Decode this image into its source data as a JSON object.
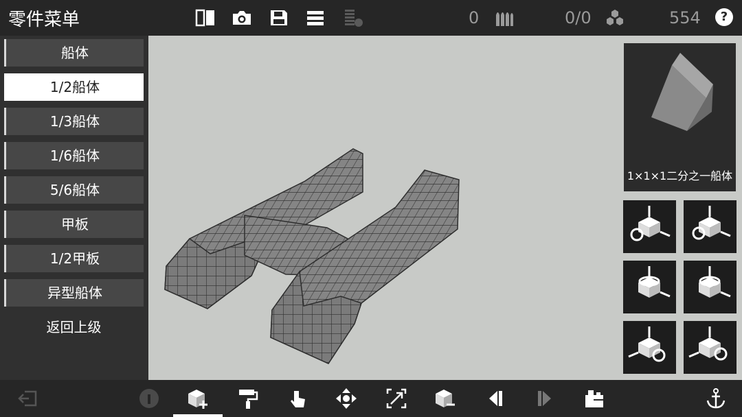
{
  "header": {
    "title": "零件菜单",
    "ammo_count": "0",
    "parts_count": "0/0",
    "points": "554",
    "help_label": "?"
  },
  "sidebar": {
    "items": [
      {
        "label": "船体",
        "selected": false
      },
      {
        "label": "1/2船体",
        "selected": true
      },
      {
        "label": "1/3船体",
        "selected": false
      },
      {
        "label": "1/6船体",
        "selected": false
      },
      {
        "label": "5/6船体",
        "selected": false
      },
      {
        "label": "甲板",
        "selected": false
      },
      {
        "label": "1/2甲板",
        "selected": false
      },
      {
        "label": "异型船体",
        "selected": false
      }
    ],
    "back_label": "返回上级"
  },
  "preview": {
    "label": "1×1×1二分之一船体"
  },
  "toolbar": {
    "active_tool": "add-block"
  },
  "colors": {
    "bar": "#262626",
    "sidebar": "#303030",
    "menu_item": "#474747",
    "viewport": "#c8cac7",
    "block": "#7b7b7b"
  }
}
